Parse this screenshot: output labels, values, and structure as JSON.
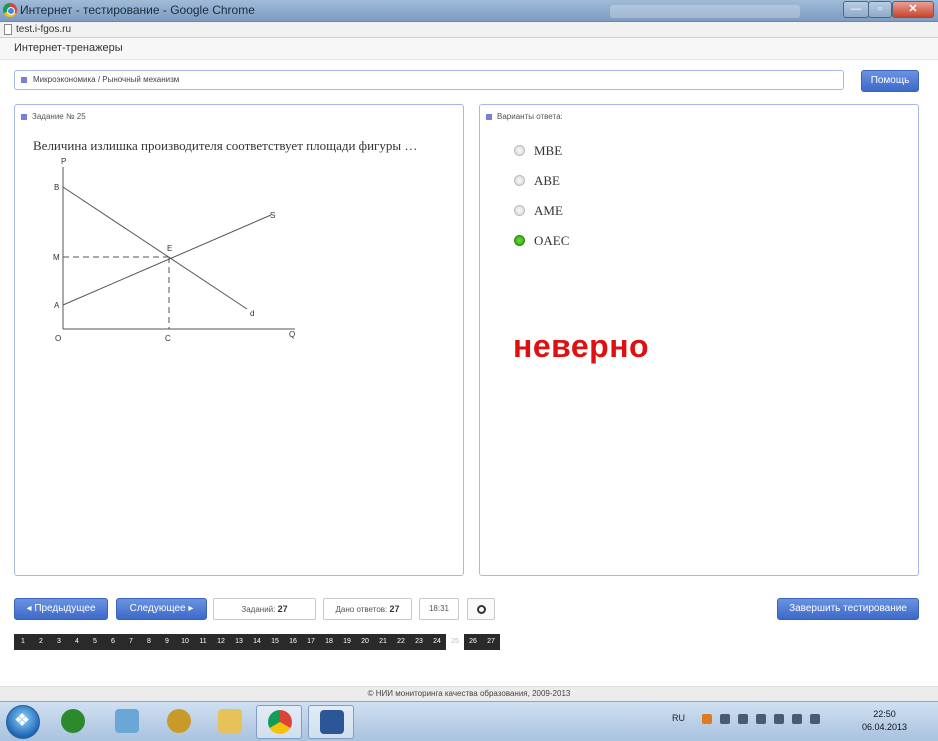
{
  "window": {
    "title": "Интернет - тестирование - Google Chrome",
    "url": "test.i-fgos.ru"
  },
  "app": {
    "title": "Интернет-тренажеры"
  },
  "breadcrumb": "Микроэкономика / Рыночный механизм",
  "help_label": "Помощь",
  "task": {
    "header": "Задание № 25",
    "question": "Величина излишка производителя соответствует площади фигуры …",
    "graph_labels": {
      "p": "P",
      "b": "B",
      "m": "M",
      "a": "A",
      "o": "O",
      "c": "C",
      "q": "Q",
      "e": "E",
      "s": "S",
      "d": "d"
    }
  },
  "answers": {
    "header": "Варианты ответа:",
    "options": [
      {
        "label": "MBE",
        "selected": false
      },
      {
        "label": "ABE",
        "selected": false
      },
      {
        "label": "AME",
        "selected": false
      },
      {
        "label": "OAEC",
        "selected": true
      }
    ]
  },
  "result": "неверно",
  "controls": {
    "prev": "Предыдущее",
    "next": "Следующее",
    "tasks_label": "Заданий:",
    "tasks_value": "27",
    "answered_label": "Дано ответов:",
    "answered_value": "27",
    "timer": "18:31",
    "finish": "Завершить тестирование"
  },
  "pager": {
    "pages": [
      "1",
      "2",
      "3",
      "4",
      "5",
      "6",
      "7",
      "8",
      "9",
      "10",
      "11",
      "12",
      "13",
      "14",
      "15",
      "16",
      "17",
      "18",
      "19",
      "20",
      "21",
      "22",
      "23",
      "24",
      "25",
      "26",
      "27"
    ],
    "current": "25"
  },
  "footer": "© НИИ мониторинга качества образования, 2009-2013",
  "taskbar": {
    "lang": "RU",
    "time": "22:50",
    "date": "06.04.2013"
  }
}
